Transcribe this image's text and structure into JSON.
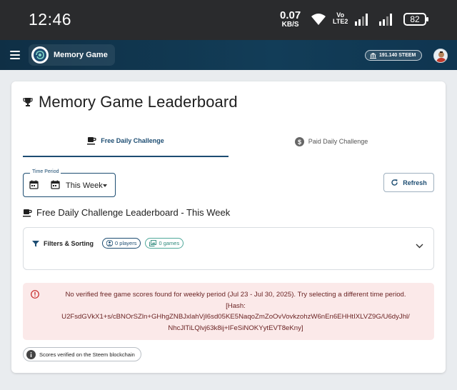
{
  "status_bar": {
    "time": "12:46",
    "speed_value": "0.07",
    "speed_unit": "KB/S",
    "volte_top": "Vo",
    "volte_bottom": "LTE2",
    "battery": "82"
  },
  "app_bar": {
    "app_name": "Memory Game",
    "wallet_balance": "191.140 STEEM"
  },
  "page": {
    "title": "Memory Game Leaderboard"
  },
  "tabs": [
    {
      "label": "Free Daily Challenge",
      "icon": "coffee-cup-icon",
      "active": true
    },
    {
      "label": "Paid Daily Challenge",
      "icon": "dollar-coin-icon",
      "active": false
    }
  ],
  "time_period": {
    "label": "Time Period",
    "value": "This Week"
  },
  "refresh_label": "Refresh",
  "leaderboard_title": "Free Daily Challenge Leaderboard - This Week",
  "filters": {
    "label": "Filters & Sorting",
    "players_chip": "0 players",
    "games_chip": "0 games"
  },
  "alert": {
    "line1": "No verified free game scores found for weekly period (Jul 23 - Jul 30, 2025). Try selecting a different time period.",
    "line2": "[Hash:",
    "line3": "U2FsdGVkX1+s/cBNOrSZln+GHhgZNBJxlahVjI6sd05KE5NaqoZmZoOvVovkzohzW6nEn6EHHtIXLVZ9G/U6dyJhl/",
    "line4": "NhcJlTiLQlvj63k8ij+lFeSiNOKYytEVT8eKny]"
  },
  "verified_note": "Scores verified on the Steem blockchain",
  "colors": {
    "primary": "#1d4d72",
    "appbar": "#123d58",
    "alert_bg": "#fbe9e9",
    "alert_text": "#6b2424",
    "games_chip": "#2f8a7c"
  }
}
